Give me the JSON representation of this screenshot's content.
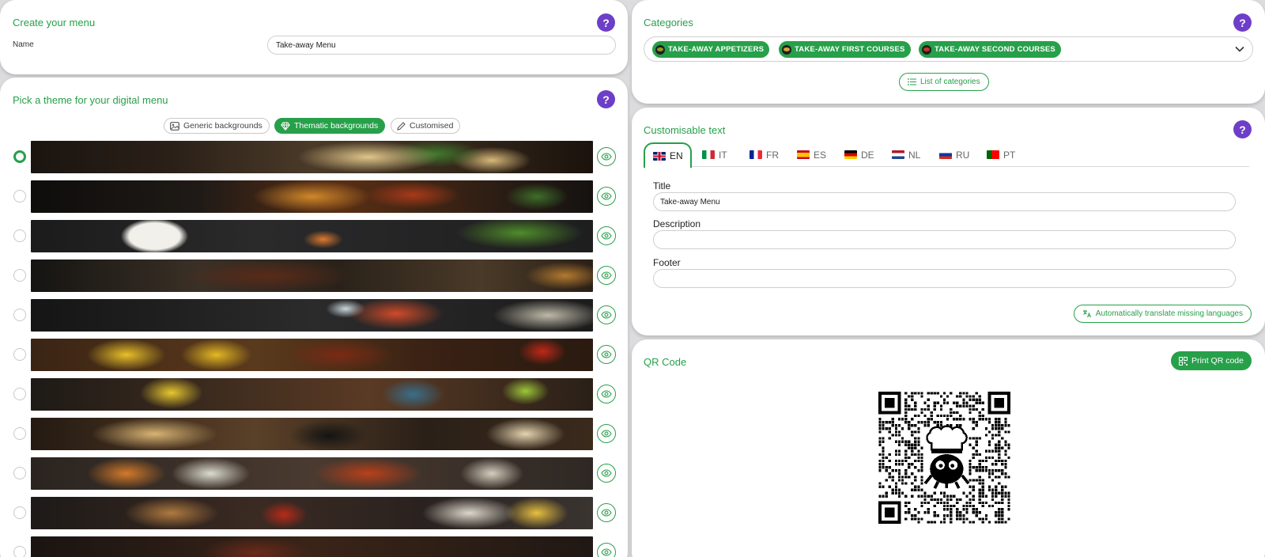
{
  "create_menu": {
    "title": "Create your menu",
    "name_label": "Name",
    "name_value": "Take-away Menu"
  },
  "theme": {
    "title": "Pick a theme for your digital menu",
    "tabs": [
      {
        "label": "Generic backgrounds",
        "icon": "image-icon",
        "active": false
      },
      {
        "label": "Thematic backgrounds",
        "icon": "gem-icon",
        "active": true
      },
      {
        "label": "Customised",
        "icon": "pencil-icon",
        "active": false
      }
    ],
    "selected_index": 0,
    "rows": [
      {
        "name": "pasta-ravioli"
      },
      {
        "name": "grilled-meat-pizza"
      },
      {
        "name": "sushi-soy-fern"
      },
      {
        "name": "steak-fries"
      },
      {
        "name": "seafood-oysters"
      },
      {
        "name": "bbq-corn"
      },
      {
        "name": "mexican-tacos"
      },
      {
        "name": "asian-noodles-dumplings"
      },
      {
        "name": "indian-curry"
      },
      {
        "name": "bread-cheese-wine"
      },
      {
        "name": "roast-meat"
      }
    ]
  },
  "categories": {
    "title": "Categories",
    "chips": [
      {
        "label": "TAKE-AWAY APPETIZERS",
        "icon": "olive-icon",
        "dot": "#8b9a2a"
      },
      {
        "label": "TAKE-AWAY FIRST COURSES",
        "icon": "pasta-icon",
        "dot": "#d4a23a"
      },
      {
        "label": "TAKE-AWAY SECOND COURSES",
        "icon": "meat-icon",
        "dot": "#c0392b"
      }
    ],
    "list_button": "List of categories"
  },
  "custom_text": {
    "title": "Customisable text",
    "languages": [
      {
        "code": "EN",
        "flag": "uk",
        "active": true
      },
      {
        "code": "IT",
        "flag": "it",
        "active": false
      },
      {
        "code": "FR",
        "flag": "fr",
        "active": false
      },
      {
        "code": "ES",
        "flag": "es",
        "active": false
      },
      {
        "code": "DE",
        "flag": "de",
        "active": false
      },
      {
        "code": "NL",
        "flag": "nl",
        "active": false
      },
      {
        "code": "RU",
        "flag": "ru",
        "active": false
      },
      {
        "code": "PT",
        "flag": "pt",
        "active": false
      }
    ],
    "title_label": "Title",
    "title_value": "Take-away Menu",
    "description_label": "Description",
    "description_value": "",
    "footer_label": "Footer",
    "footer_value": "",
    "translate_button": "Automatically translate missing languages"
  },
  "qr": {
    "title": "QR Code",
    "print_button": "Print QR code"
  },
  "colors": {
    "accent": "#27a04a",
    "help": "#6d3fc8",
    "background": "#dcdcde"
  }
}
